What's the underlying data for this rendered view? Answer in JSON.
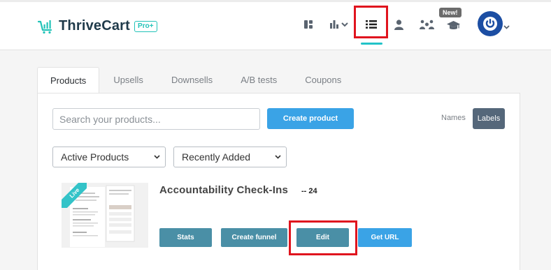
{
  "header": {
    "logo_text": "ThriveCart",
    "pro_badge": "Pro+",
    "new_badge": "New!",
    "nav_icons": [
      "dashboard-icon",
      "stats-dropdown-icon",
      "products-list-icon",
      "user-icon",
      "affiliates-icon",
      "learn-icon"
    ],
    "brand_color": "#22c3b8"
  },
  "tabs": [
    {
      "label": "Products",
      "active": true
    },
    {
      "label": "Upsells"
    },
    {
      "label": "Downsells"
    },
    {
      "label": "A/B tests"
    },
    {
      "label": "Coupons"
    }
  ],
  "toolbar": {
    "search_placeholder": "Search your products...",
    "create_label": "Create product",
    "names_label": "Names",
    "labels_label": "Labels"
  },
  "filters": {
    "status_selected": "Active Products",
    "sort_selected": "Recently Added"
  },
  "product": {
    "title": "Accountability Check-Ins",
    "count": "-- 24",
    "status": "Live",
    "actions": {
      "stats": "Stats",
      "create_funnel": "Create funnel",
      "edit": "Edit",
      "get_url": "Get URL"
    }
  },
  "colors": {
    "highlight": "#e0141e",
    "primary_blue": "#3aa3e6",
    "teal_button": "#4a8fa6",
    "avatar_blue": "#1c4ea3"
  }
}
